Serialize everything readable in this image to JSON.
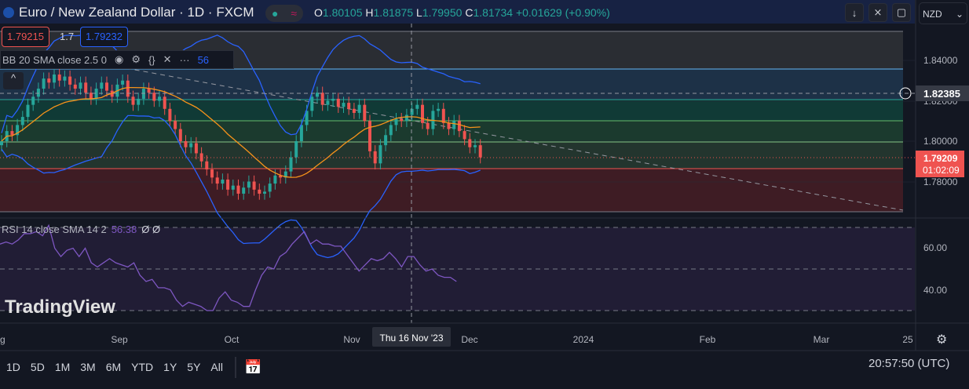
{
  "header": {
    "symbol": "Euro / New Zealand Dollar · 1D · FXCM",
    "status_icon": "≈",
    "ohlc": {
      "o_label": "O",
      "o": "1.80105",
      "h_label": "H",
      "h": "1.81875",
      "l_label": "L",
      "l": "1.79950",
      "c_label": "C",
      "c": "1.81734",
      "change": "+0.01629 (+0.90%)"
    },
    "sell_price": "1.79215",
    "spread": "1.7",
    "buy_price": "1.79232"
  },
  "indicators": {
    "bb": "BB 20 SMA close 2.5 0",
    "bb_value": "56",
    "rsi": "RSI 14 close SMA 14 2",
    "rsi_value": "56.38",
    "rsi_extra": "Ø Ø"
  },
  "price_axis": {
    "currency": "NZD",
    "ticks": [
      "1.84000",
      "1.82000",
      "1.80000",
      "1.78000"
    ],
    "crosshair_price": "1.82385",
    "last_price": "1.79209",
    "countdown": "01:02:09"
  },
  "rsi_axis": {
    "ticks": [
      "60.00",
      "40.00"
    ]
  },
  "time_axis": {
    "ticks": [
      "g",
      "Sep",
      "Oct",
      "Nov",
      "Dec",
      "2024",
      "Feb",
      "Mar",
      "25"
    ],
    "crosshair_date": "Thu 16 Nov '23"
  },
  "ranges": [
    "1D",
    "5D",
    "1M",
    "3M",
    "6M",
    "YTD",
    "1Y",
    "5Y",
    "All"
  ],
  "clock": "20:57:50 (UTC)",
  "watermark": "TradingView",
  "colors": {
    "up": "#26a69a",
    "down": "#ef5350",
    "bb": "#2962ff",
    "sma": "#f7931a",
    "rsi": "#7e57c2"
  },
  "series": {
    "closes": [
      1.8,
      1.805,
      1.803,
      1.808,
      1.812,
      1.818,
      1.822,
      1.826,
      1.831,
      1.829,
      1.833,
      1.83,
      1.832,
      1.828,
      1.826,
      1.829,
      1.824,
      1.821,
      1.826,
      1.829,
      1.825,
      1.822,
      1.828,
      1.83,
      1.822,
      1.818,
      1.821,
      1.826,
      1.824,
      1.82,
      1.822,
      1.816,
      1.81,
      1.806,
      1.8,
      1.797,
      1.799,
      1.794,
      1.79,
      1.786,
      1.782,
      1.779,
      1.781,
      1.776,
      1.778,
      1.774,
      1.777,
      1.78,
      1.776,
      1.774,
      1.775,
      1.779,
      1.783,
      1.782,
      1.785,
      1.792,
      1.8,
      1.808,
      1.815,
      1.822,
      1.824,
      1.818,
      1.82,
      1.821,
      1.817,
      1.819,
      1.816,
      1.814,
      1.818,
      1.81,
      1.795,
      1.789,
      1.798,
      1.803,
      1.808,
      1.811,
      1.81,
      1.813,
      1.816,
      1.818,
      1.809,
      1.806,
      1.815,
      1.816,
      1.809,
      1.806,
      1.81,
      1.805,
      1.801,
      1.797,
      1.798,
      1.792
    ],
    "rsi": [
      62,
      63,
      62,
      64,
      67,
      67,
      68,
      66,
      71,
      60,
      56,
      59,
      60,
      56,
      60,
      53,
      51,
      53,
      55,
      53,
      52,
      51,
      53,
      47,
      44,
      45,
      41,
      41,
      40,
      35,
      32,
      34,
      33,
      32,
      30,
      30,
      36,
      39,
      35,
      34,
      32,
      32,
      40,
      47,
      51,
      50,
      56,
      58,
      62,
      65,
      68,
      62,
      64,
      62,
      62,
      61,
      61,
      57,
      53,
      49,
      52,
      55,
      54,
      55,
      58,
      55,
      51,
      56,
      56,
      52,
      49,
      50,
      47,
      46,
      46,
      44
    ]
  }
}
